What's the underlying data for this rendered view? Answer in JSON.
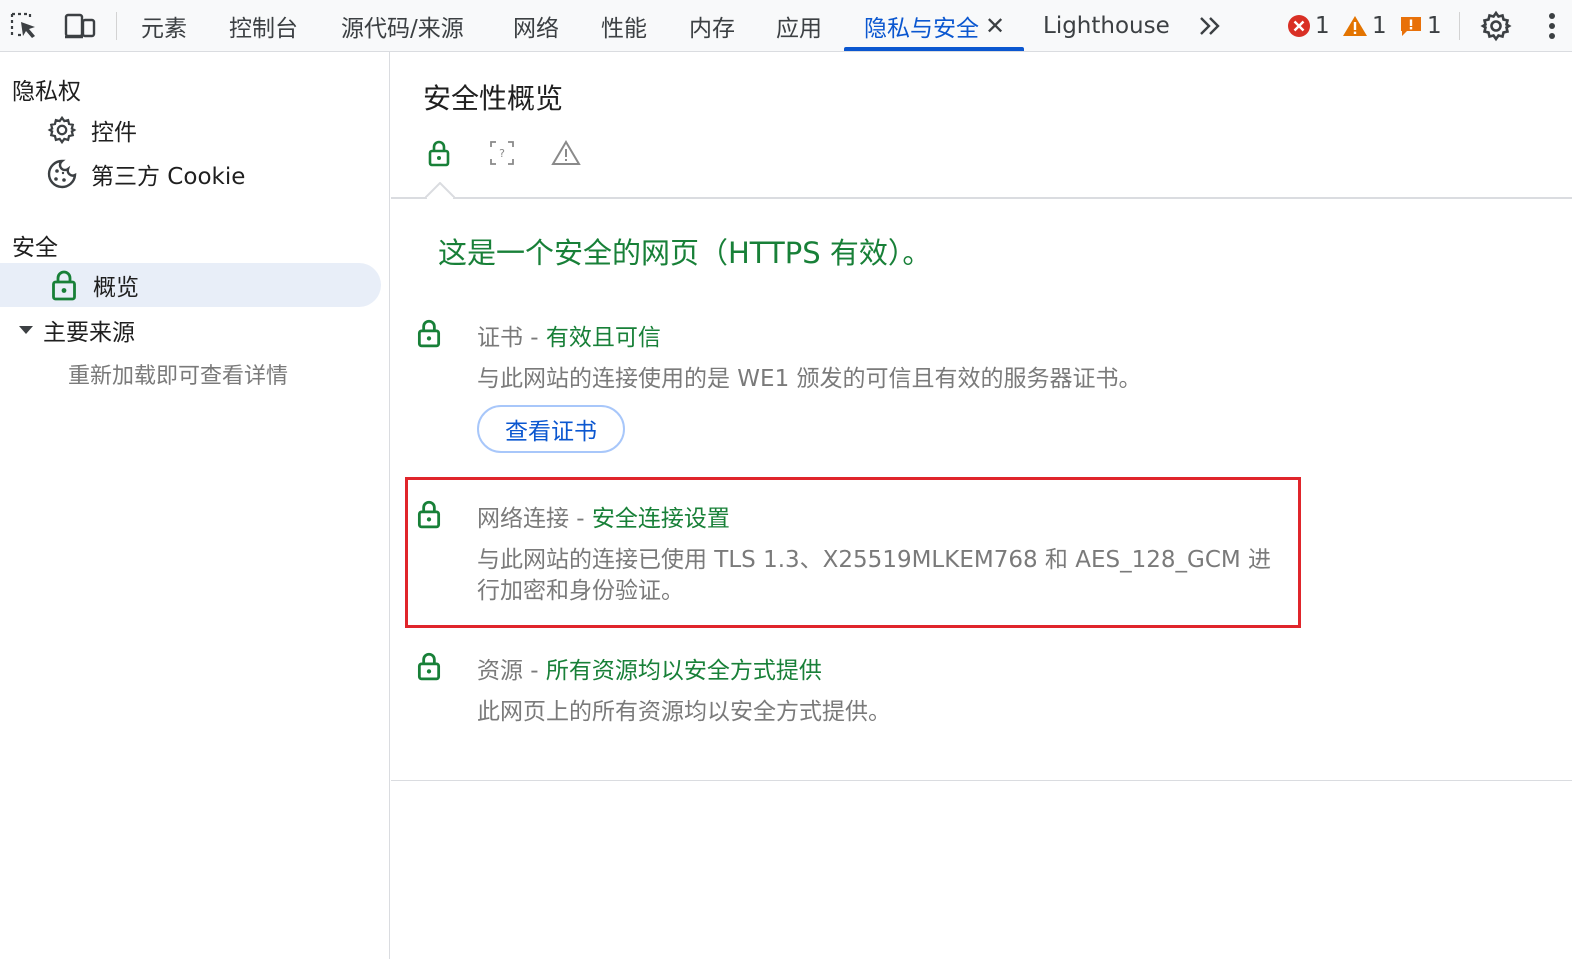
{
  "toolbar": {
    "tabs": [
      {
        "label": "元素"
      },
      {
        "label": "控制台"
      },
      {
        "label": "源代码/来源"
      },
      {
        "label": "网络"
      },
      {
        "label": "性能"
      },
      {
        "label": "内存"
      },
      {
        "label": "应用"
      },
      {
        "label": "隐私与安全",
        "active": true
      },
      {
        "label": "Lighthouse"
      }
    ],
    "errors_count": "1",
    "warnings_count": "1",
    "issues_count": "1",
    "colors": {
      "accent": "#0b57d0",
      "error": "#d93025",
      "warning": "#e37400"
    }
  },
  "sidebar": {
    "privacy_heading": "隐私权",
    "privacy_items": [
      {
        "label": "控件",
        "icon": "gear-icon"
      },
      {
        "label": "第三方 Cookie",
        "icon": "cookie-icon"
      }
    ],
    "security_heading": "安全",
    "security_items": [
      {
        "label": "概览",
        "icon": "lock-icon",
        "selected": true
      }
    ],
    "main_origin_label": "主要来源",
    "reload_hint": "重新加载即可查看详情"
  },
  "main": {
    "title": "安全性概览",
    "summary": "这是一个安全的网页（HTTPS 有效）。",
    "rows": [
      {
        "title": "证书 - ",
        "status": "有效且可信",
        "description": "与此网站的连接使用的是 WE1 颁发的可信且有效的服务器证书。"
      },
      {
        "title": "网络连接 - ",
        "status": "安全连接设置",
        "description": "与此网站的连接已使用 TLS 1.3、X25519MLKEM768 和 AES_128_GCM 进行加密和身份验证。"
      },
      {
        "title": "资源 - ",
        "status": "所有资源均以安全方式提供",
        "description": "此网页上的所有资源均以安全方式提供。"
      }
    ],
    "view_cert_button": "查看证书",
    "colors": {
      "secure": "#188038",
      "highlight": "#e0252b"
    }
  }
}
